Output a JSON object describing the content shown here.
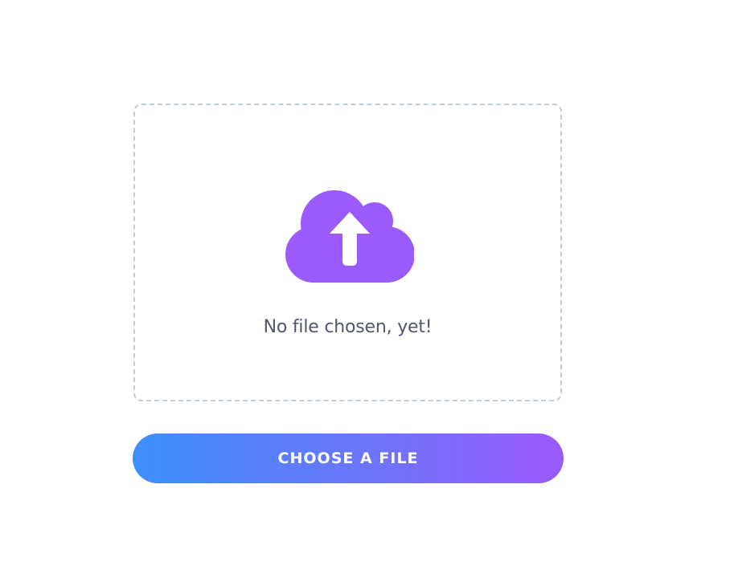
{
  "upload": {
    "status_text": "No file chosen, yet!",
    "icon": "cloud-upload-icon",
    "button_label": "CHOOSE A FILE"
  },
  "colors": {
    "icon_purple": "#9b5afc",
    "button_gradient_start": "#3d8ffb",
    "button_gradient_end": "#9b5afc",
    "dashed_border": "#c3cfd8",
    "status_text": "#535670"
  }
}
